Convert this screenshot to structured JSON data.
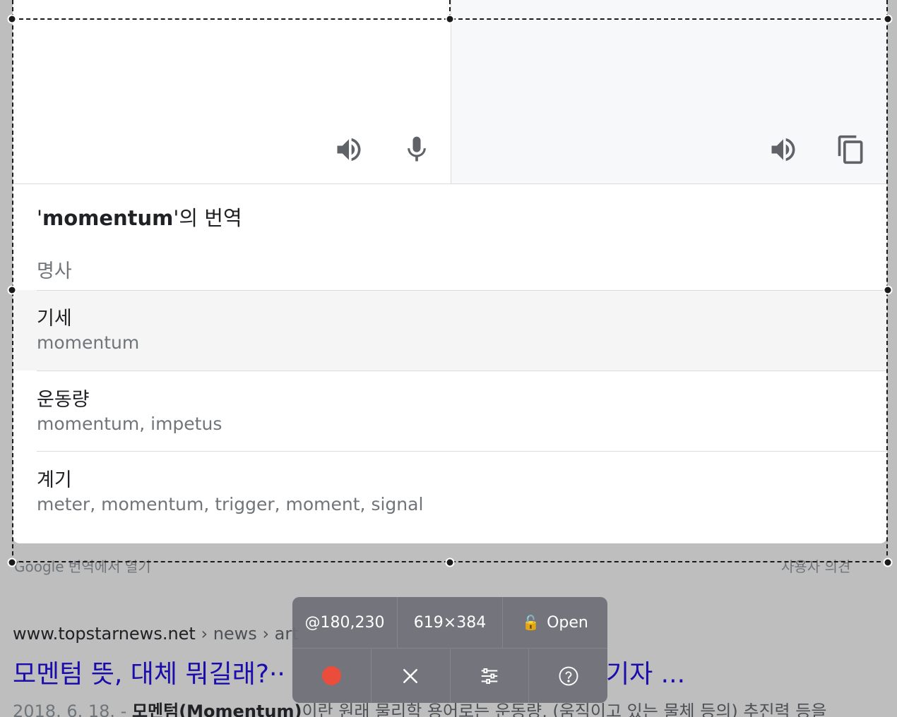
{
  "card": {
    "source_speak_icon": "volume-icon",
    "mic_icon": "microphone-icon",
    "target_speak_icon": "volume-icon",
    "copy_icon": "copy-icon",
    "title_quote_open": "'",
    "title_word": "momentum",
    "title_suffix": "'의 번역",
    "part_of_speech": "명사",
    "entries": [
      {
        "word": "기세",
        "synonyms": "momentum"
      },
      {
        "word": "운동량",
        "synonyms": "momentum, impetus"
      },
      {
        "word": "계기",
        "synonyms": "meter, momentum, trigger, moment, signal"
      }
    ],
    "footer_left": "Google 번역에서 열기",
    "footer_right": "사용자 의견"
  },
  "result": {
    "site": "www.topstarnews.net",
    "crumbs": " › news › art",
    "title_left": "모멘텀 뜻, 대체 뭐길래?··",
    "title_right": "기자 ...",
    "snippet_date": "2018. 6. 18. - ",
    "snippet_bold": "모멘텀(Momentum)",
    "snippet_rest": "이란 원래 물리학 용어로는 운동량, (움직이고 있는 물체 등의) 추진력 등을"
  },
  "toolbar": {
    "position": "@180,230",
    "size": "619×384",
    "lock_label": "Open",
    "lock_icon": "unlock-icon",
    "record_icon": "record-icon",
    "close_icon": "close-icon",
    "settings_icon": "sliders-icon",
    "help_icon": "help-icon",
    "record_color": "#eb4d3d"
  },
  "colors": {
    "selection_border": "#1a1a1a",
    "link_title": "#1a0dab",
    "backdrop": "#bebebe"
  }
}
